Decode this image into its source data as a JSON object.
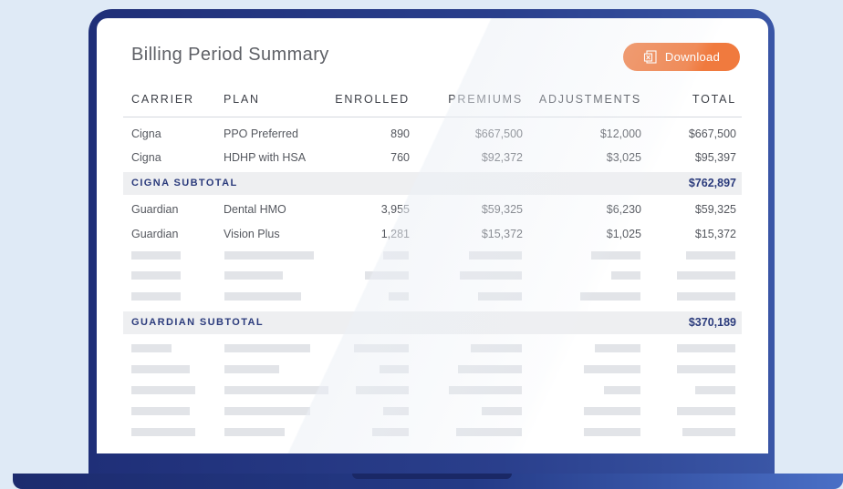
{
  "report": {
    "title": "Billing Period Summary",
    "download_label": "Download"
  },
  "columns": [
    "CARRIER",
    "PLAN",
    "ENROLLED",
    "PREMIUMS",
    "ADJUSTMENTS",
    "TOTAL"
  ],
  "rows": [
    {
      "carrier": "Cigna",
      "plan": "PPO Preferred",
      "enrolled": "890",
      "premiums": "$667,500",
      "adjustments": "$12,000",
      "total": "$667,500"
    },
    {
      "carrier": "Cigna",
      "plan": "HDHP with HSA",
      "enrolled": "760",
      "premiums": "$92,372",
      "adjustments": "$3,025",
      "total": "$95,397"
    },
    {
      "carrier": "Guardian",
      "plan": "Dental HMO",
      "enrolled": "3,955",
      "premiums": "$59,325",
      "adjustments": "$6,230",
      "total": "$59,325"
    },
    {
      "carrier": "Guardian",
      "plan": "Vision Plus",
      "enrolled": "1,281",
      "premiums": "$15,372",
      "adjustments": "$1,025",
      "total": "$15,372"
    }
  ],
  "subtotals": {
    "cigna": {
      "label": "CIGNA SUBTOTAL",
      "value": "$762,897"
    },
    "guardian": {
      "label": "GUARDIAN SUBTOTAL",
      "value": "$370,189"
    }
  },
  "colors": {
    "accent": "#f07a3e",
    "navy": "#2b3b7c",
    "laptop": "#1f2f78",
    "background": "#dfeaf6"
  }
}
